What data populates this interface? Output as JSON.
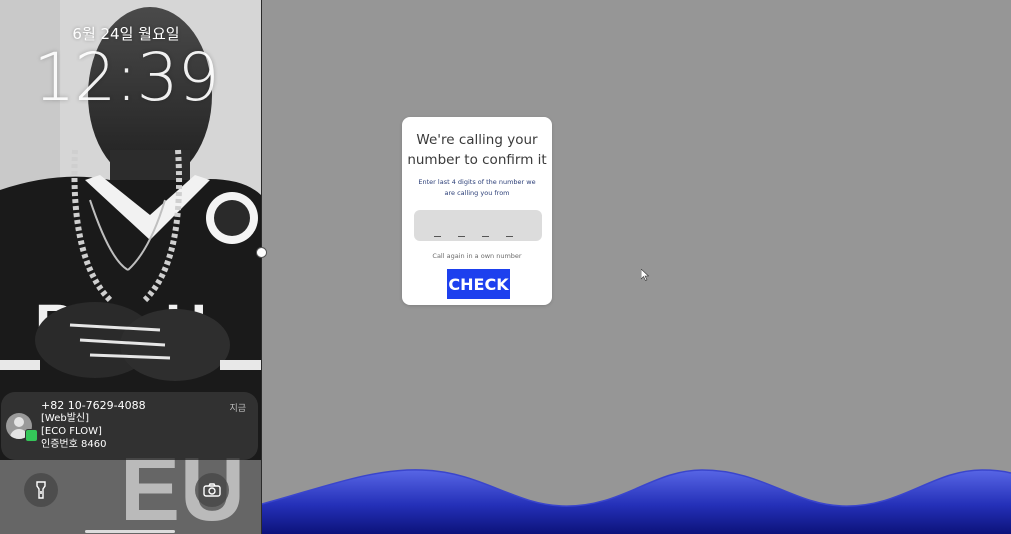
{
  "lock_screen": {
    "date": "6월 24일 월요일",
    "time": "12:39",
    "notification": {
      "sender": "+82 10-7629-4088",
      "time": "지금",
      "lines": [
        "[Web발신]",
        "[ECO FLOW]",
        "인증번호 8460"
      ]
    },
    "buttons": [
      "flashlight-icon",
      "camera-icon"
    ]
  },
  "web": {
    "title_line1": "We're calling your",
    "title_line2": "number to confirm it",
    "subtitle_line1": "Enter last 4 digits of the number we",
    "subtitle_line2": "are calling you from",
    "code_value": "",
    "code_placeholder": "_ _ _ _",
    "call_again": "Call again in a own number",
    "check_button": "CHECK",
    "colors": {
      "background": "#969696",
      "button": "#1d40ee",
      "wave_top": "#5866e6",
      "wave_bottom": "#0c127a"
    }
  }
}
